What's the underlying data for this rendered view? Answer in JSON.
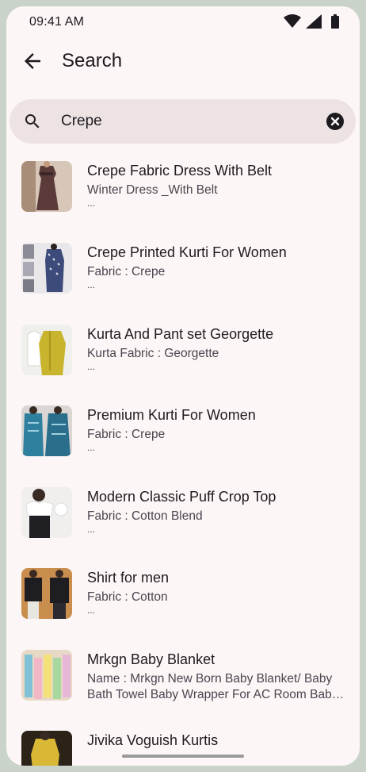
{
  "status_bar": {
    "time": "09:41 AM"
  },
  "header": {
    "title": "Search"
  },
  "search": {
    "value": "Crepe"
  },
  "results": [
    {
      "title": "Crepe Fabric Dress With Belt",
      "subtitle": "Winter Dress _With Belt",
      "more": "..."
    },
    {
      "title": "Crepe Printed Kurti For Women",
      "subtitle": "Fabric : Crepe",
      "more": "..."
    },
    {
      "title": "Kurta And Pant set Georgette",
      "subtitle": "Kurta Fabric : Georgette",
      "more": "..."
    },
    {
      "title": "Premium Kurti For Women",
      "subtitle": "Fabric : Crepe",
      "more": "..."
    },
    {
      "title": "Modern Classic Puff Crop Top",
      "subtitle": "Fabric : Cotton Blend",
      "more": "..."
    },
    {
      "title": "Shirt for men",
      "subtitle": "Fabric : Cotton",
      "more": "..."
    },
    {
      "title": "Mrkgn Baby Blanket",
      "subtitle": "Name : Mrkgn New Born Baby Blanket/ Baby Bath Towel Baby Wrapper For AC Room Bab…",
      "more": ""
    },
    {
      "title": "Jivika Voguish Kurtis",
      "subtitle": "",
      "more": ""
    }
  ]
}
